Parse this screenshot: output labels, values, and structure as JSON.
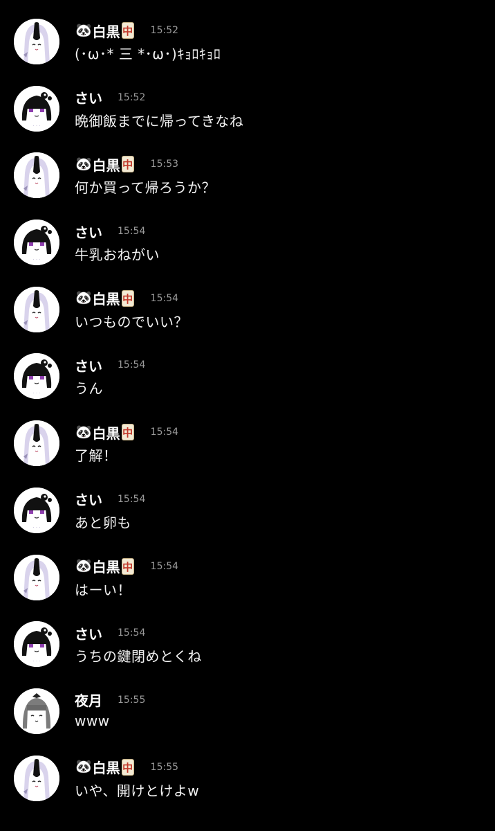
{
  "colors": {
    "background": "#000000",
    "name": "#ffffff",
    "timestamp": "#9a9a9a",
    "message": "#f2f2f2"
  },
  "messages": [
    {
      "user": "shirokuro",
      "name": "白黒",
      "prefix": "🐼",
      "tile": "中",
      "time": "15:52",
      "text": "(･ω･* 三 *･ω･)ｷｮﾛｷｮﾛ"
    },
    {
      "user": "sai",
      "name": "さい",
      "time": "15:52",
      "text": "晩御飯までに帰ってきなね"
    },
    {
      "user": "shirokuro",
      "name": "白黒",
      "prefix": "🐼",
      "tile": "中",
      "time": "15:53",
      "text": "何か買って帰ろうか？"
    },
    {
      "user": "sai",
      "name": "さい",
      "time": "15:54",
      "text": "牛乳おねがい"
    },
    {
      "user": "shirokuro",
      "name": "白黒",
      "prefix": "🐼",
      "tile": "中",
      "time": "15:54",
      "text": "いつものでいい？"
    },
    {
      "user": "sai",
      "name": "さい",
      "time": "15:54",
      "text": "うん"
    },
    {
      "user": "shirokuro",
      "name": "白黒",
      "prefix": "🐼",
      "tile": "中",
      "time": "15:54",
      "text": "了解！"
    },
    {
      "user": "sai",
      "name": "さい",
      "time": "15:54",
      "text": "あと卵も"
    },
    {
      "user": "shirokuro",
      "name": "白黒",
      "prefix": "🐼",
      "tile": "中",
      "time": "15:54",
      "text": "はーい！"
    },
    {
      "user": "sai",
      "name": "さい",
      "time": "15:54",
      "text": "うちの鍵閉めとくね"
    },
    {
      "user": "yozuki",
      "name": "夜月",
      "time": "15:55",
      "text": "www"
    },
    {
      "user": "shirokuro",
      "name": "白黒",
      "prefix": "🐼",
      "tile": "中",
      "time": "15:55",
      "text": "いや、開けとけよw"
    }
  ]
}
